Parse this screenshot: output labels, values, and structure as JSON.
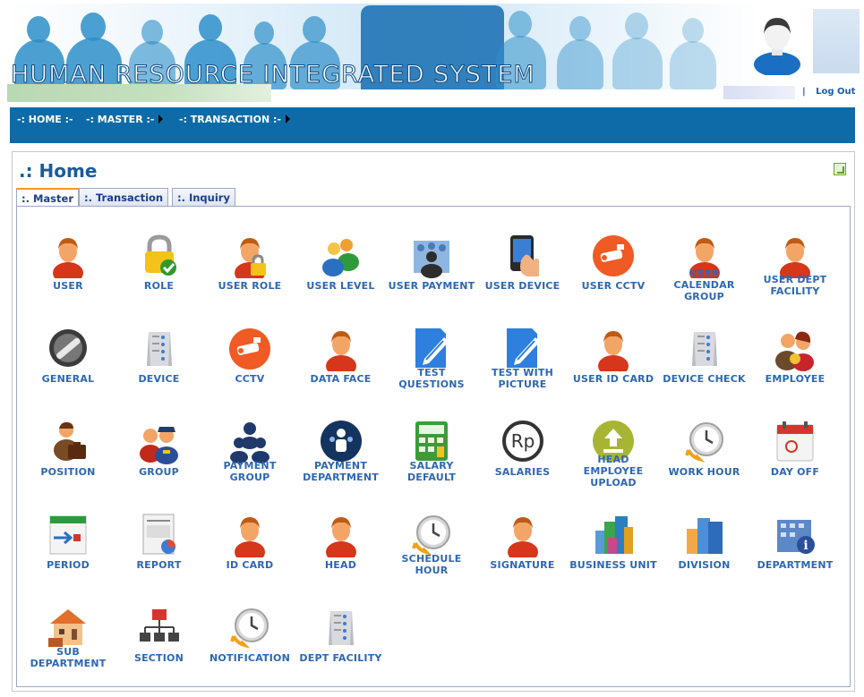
{
  "header": {
    "title": "HUMAN RESOURCE INTEGRATED SYSTEM",
    "logout_label": "Log Out",
    "separator": "|"
  },
  "nav": {
    "items": [
      {
        "label": "-: HOME :-",
        "has_arrow": false
      },
      {
        "label": "-: MASTER :-",
        "has_arrow": true
      },
      {
        "label": "-: TRANSACTION :-",
        "has_arrow": true
      }
    ]
  },
  "page": {
    "title": ".: Home"
  },
  "tabs": [
    {
      "label": ":. Master",
      "active": true
    },
    {
      "label": ":. Transaction",
      "active": false
    },
    {
      "label": ":. Inquiry",
      "active": false
    }
  ],
  "menu": [
    {
      "label": "USER",
      "icon": "user-icon"
    },
    {
      "label": "ROLE",
      "icon": "lock-check-icon"
    },
    {
      "label": "USER ROLE",
      "icon": "user-lock-icon"
    },
    {
      "label": "USER LEVEL",
      "icon": "users-group-icon"
    },
    {
      "label": "USER PAYMENT",
      "icon": "people-crowd-icon"
    },
    {
      "label": "USER DEVICE",
      "icon": "hand-device-icon"
    },
    {
      "label": "USER CCTV",
      "icon": "cctv-icon"
    },
    {
      "label": "USER CALENDAR GROUP",
      "icon": "user-icon"
    },
    {
      "label": "USER DEPT FACILITY",
      "icon": "user-icon"
    },
    {
      "label": "GENERAL",
      "icon": "wrench-icon"
    },
    {
      "label": "DEVICE",
      "icon": "server-icon"
    },
    {
      "label": "CCTV",
      "icon": "cctv-icon"
    },
    {
      "label": "DATA FACE",
      "icon": "user-icon"
    },
    {
      "label": "TEST QUESTIONS",
      "icon": "edit-document-icon"
    },
    {
      "label": "TEST WITH PICTURE",
      "icon": "edit-document-icon"
    },
    {
      "label": "USER ID CARD",
      "icon": "user-icon"
    },
    {
      "label": "DEVICE CHECK",
      "icon": "server-icon"
    },
    {
      "label": "EMPLOYEE",
      "icon": "employee-icon"
    },
    {
      "label": "POSITION",
      "icon": "briefcase-person-icon"
    },
    {
      "label": "GROUP",
      "icon": "police-group-icon"
    },
    {
      "label": "PAYMENT GROUP",
      "icon": "group-navy-icon"
    },
    {
      "label": "PAYMENT DEPARTMENT",
      "icon": "department-circle-icon"
    },
    {
      "label": "SALARY DEFAULT",
      "icon": "calculator-icon"
    },
    {
      "label": "SALARIES",
      "icon": "rupiah-icon"
    },
    {
      "label": "HEAD EMPLOYEE UPLOAD",
      "icon": "upload-icon"
    },
    {
      "label": "WORK HOUR",
      "icon": "clock-icon"
    },
    {
      "label": "DAY OFF",
      "icon": "calendar-icon"
    },
    {
      "label": "PERIOD",
      "icon": "calendar-arrow-icon"
    },
    {
      "label": "REPORT",
      "icon": "report-icon"
    },
    {
      "label": "ID CARD",
      "icon": "user-icon"
    },
    {
      "label": "HEAD",
      "icon": "user-icon"
    },
    {
      "label": "SCHEDULE HOUR",
      "icon": "clock-icon"
    },
    {
      "label": "SIGNATURE",
      "icon": "user-icon"
    },
    {
      "label": "BUSINESS UNIT",
      "icon": "buildings-icon"
    },
    {
      "label": "DIVISION",
      "icon": "buildings-blue-icon"
    },
    {
      "label": "DEPARTMENT",
      "icon": "building-info-icon"
    },
    {
      "label": "SUB DEPARTMENT",
      "icon": "house-icon"
    },
    {
      "label": "SECTION",
      "icon": "org-chart-icon"
    },
    {
      "label": "NOTIFICATION",
      "icon": "clock-icon"
    },
    {
      "label": "DEPT FACILITY",
      "icon": "server-icon"
    }
  ]
}
